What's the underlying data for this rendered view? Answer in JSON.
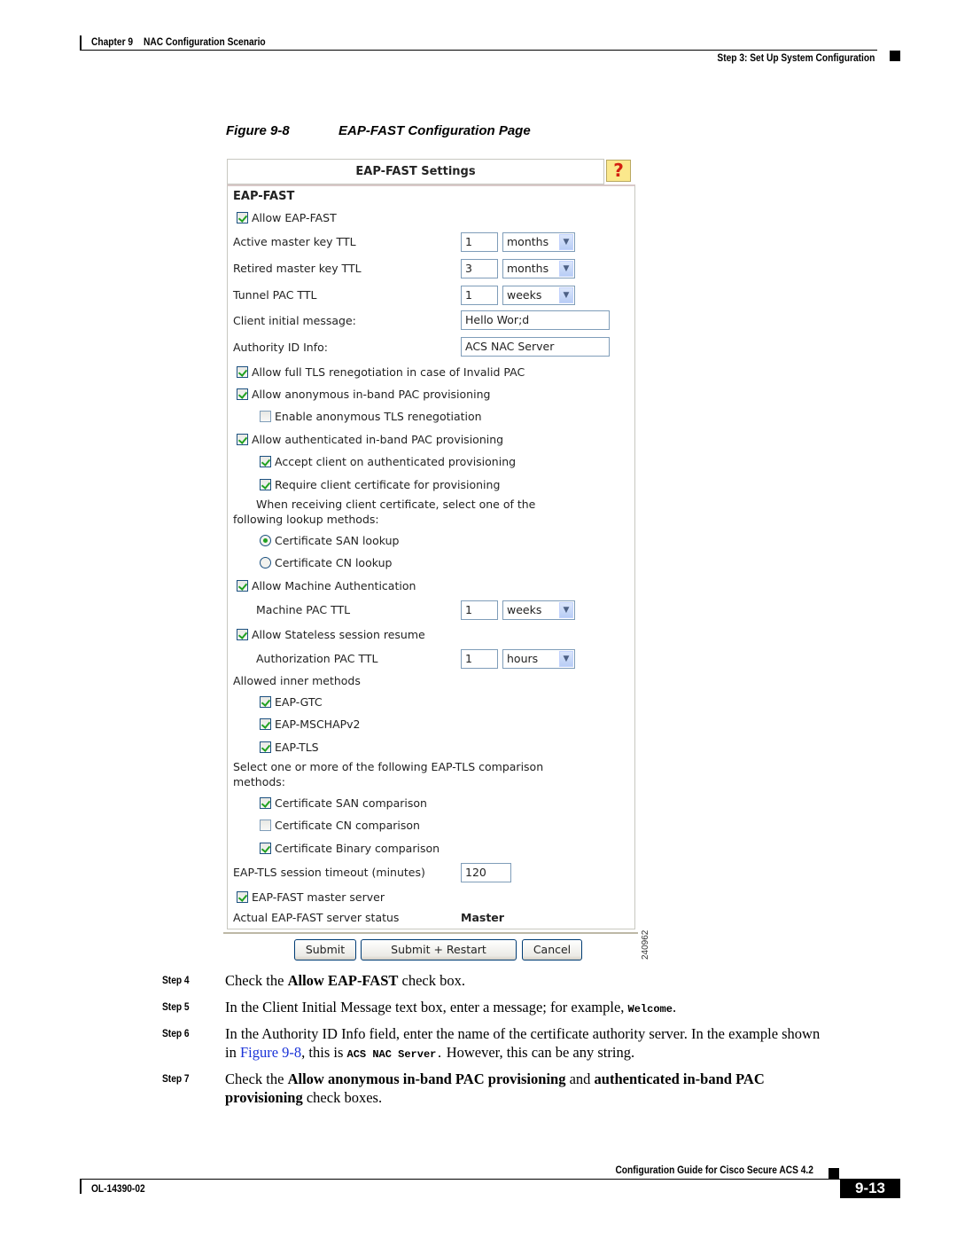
{
  "header": {
    "chapter": "Chapter 9",
    "chapter_title": "NAC Configuration Scenario",
    "section": "Step 3: Set Up System Configuration"
  },
  "figure": {
    "number": "Figure 9-8",
    "title": "EAP-FAST Configuration Page",
    "id": "240962"
  },
  "panel": {
    "title": "EAP-FAST Settings",
    "help_icon": "?",
    "section_head": "EAP-FAST",
    "allow_eap_fast": {
      "label": "Allow EAP-FAST",
      "checked": true
    },
    "active_master_key_ttl": {
      "label": "Active master key TTL",
      "value": "1",
      "unit": "months"
    },
    "retired_master_key_ttl": {
      "label": "Retired master key TTL",
      "value": "3",
      "unit": "months"
    },
    "tunnel_pac_ttl": {
      "label": "Tunnel PAC TTL",
      "value": "1",
      "unit": "weeks"
    },
    "client_initial_message": {
      "label": "Client initial message:",
      "value": "Hello Wor;d"
    },
    "authority_id_info": {
      "label": "Authority ID Info:",
      "value": "ACS NAC Server"
    },
    "allow_full_tls": {
      "label": "Allow full TLS renegotiation in case of Invalid PAC",
      "checked": true
    },
    "allow_anon_inband": {
      "label": "Allow anonymous in-band PAC provisioning",
      "checked": true
    },
    "enable_anon_tls": {
      "label": "Enable anonymous TLS renegotiation",
      "checked": false
    },
    "allow_auth_inband": {
      "label": "Allow authenticated in-band PAC provisioning",
      "checked": true
    },
    "accept_client": {
      "label": "Accept client on authenticated provisioning",
      "checked": true
    },
    "require_client_cert": {
      "label": "Require client certificate for provisioning",
      "checked": true
    },
    "lookup_note_line1": "When receiving client certificate, select one of the",
    "lookup_note_line2": "following lookup methods:",
    "cert_san_lookup": {
      "label": "Certificate SAN lookup",
      "selected": true
    },
    "cert_cn_lookup": {
      "label": "Certificate CN lookup",
      "selected": false
    },
    "allow_machine_auth": {
      "label": "Allow Machine Authentication",
      "checked": true
    },
    "machine_pac_ttl": {
      "label": "Machine PAC TTL",
      "value": "1",
      "unit": "weeks"
    },
    "allow_stateless": {
      "label": "Allow Stateless session resume",
      "checked": true
    },
    "authorization_pac_ttl": {
      "label": "Authorization PAC TTL",
      "value": "1",
      "unit": "hours"
    },
    "allowed_inner_methods": "Allowed inner methods",
    "eap_gtc": {
      "label": "EAP-GTC",
      "checked": true
    },
    "eap_mschapv2": {
      "label": "EAP-MSCHAPv2",
      "checked": true
    },
    "eap_tls": {
      "label": "EAP-TLS",
      "checked": true
    },
    "comparison_note_line1": "Select one or more of the following EAP-TLS comparison",
    "comparison_note_line2": "methods:",
    "cert_san_comparison": {
      "label": "Certificate SAN comparison",
      "checked": true
    },
    "cert_cn_comparison": {
      "label": "Certificate CN comparison",
      "checked": false
    },
    "cert_binary_comparison": {
      "label": "Certificate Binary comparison",
      "checked": true
    },
    "eap_tls_timeout": {
      "label": "EAP-TLS session timeout (minutes)",
      "value": "120"
    },
    "master_server": {
      "label": "EAP-FAST master server",
      "checked": true
    },
    "server_status": {
      "label": "Actual EAP-FAST server status",
      "value": "Master"
    }
  },
  "buttons": {
    "submit": "Submit",
    "submit_restart": "Submit + Restart",
    "cancel": "Cancel"
  },
  "steps": [
    {
      "label": "Step 4",
      "pre": "Check the ",
      "bold": "Allow EAP-FAST",
      "post": " check box."
    },
    {
      "label": "Step 5",
      "pre": "In the Client Initial Message text box, enter a message; for example, ",
      "mono": "Welcome",
      "post": "."
    },
    {
      "label": "Step 6",
      "line1": "In the Authority ID Info field, enter the name of the certificate authority server. In the example shown",
      "pre": "in ",
      "link": "Figure 9-8",
      "mid": ", this is ",
      "mono": "ACS NAC Server.",
      "post": " However, this can be any string."
    },
    {
      "label": "Step 7",
      "pre": "Check the ",
      "bold1": "Allow anonymous in-band PAC provisioning",
      "mid": " and ",
      "bold2": "authenticated in-band PAC",
      "bold3": "provisioning",
      "post": " check boxes."
    }
  ],
  "footer": {
    "guide": "Configuration Guide for Cisco Secure ACS 4.2",
    "doc_number": "OL-14390-02",
    "page": "9-13"
  }
}
